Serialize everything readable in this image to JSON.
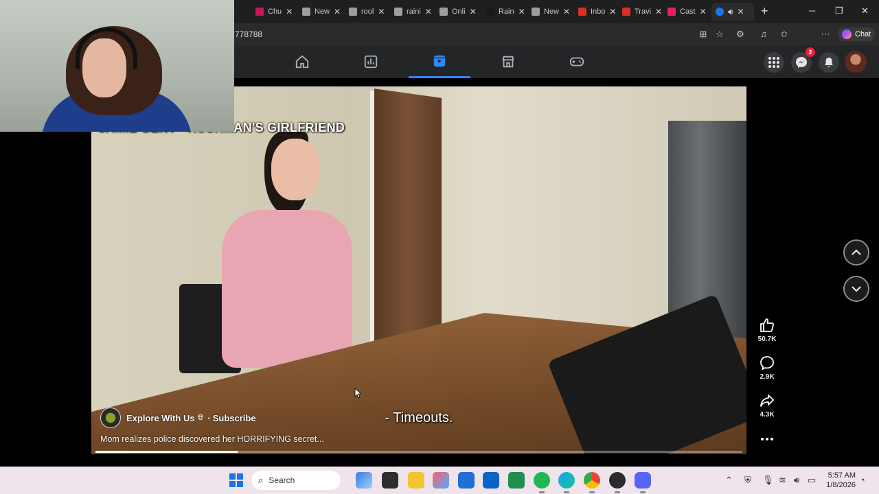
{
  "browser": {
    "tabs": [
      {
        "label": "",
        "favicon_color": "#6b6b6b"
      },
      {
        "label": "Chu",
        "favicon_color": "#c2185b"
      },
      {
        "label": "New",
        "favicon_color": "#9e9e9e"
      },
      {
        "label": "rool",
        "favicon_color": "#9e9e9e"
      },
      {
        "label": "raini",
        "favicon_color": "#9e9e9e"
      },
      {
        "label": "Onli",
        "favicon_color": "#9e9e9e"
      },
      {
        "label": "Rain",
        "favicon_color": "#1a1a1a"
      },
      {
        "label": "New",
        "favicon_color": "#9e9e9e"
      },
      {
        "label": "Inbo",
        "favicon_color": "#d93025"
      },
      {
        "label": "Travi",
        "favicon_color": "#d93025"
      },
      {
        "label": "Cast",
        "favicon_color": "#e91e63"
      }
    ],
    "url": "778788",
    "chat_label": "Chat"
  },
  "facebook": {
    "messenger_badge": "2",
    "active_tab": "reels"
  },
  "reel": {
    "top_caption": "JAMIE GENT - RUSHMAN'S GIRLFRIEND",
    "subtitle": "- Timeouts.",
    "channel_name": "Explore With Us",
    "subscribe_label": "Subscribe",
    "separator": "·",
    "description": "Mom realizes police discovered her HORRIFYING secret...",
    "progress": 0.22,
    "likes": "50.7K",
    "comments": "2.9K",
    "shares": "4.3K"
  },
  "taskbar": {
    "search_placeholder": "Search",
    "time": "5:57 AM",
    "date": "1/8/2026"
  },
  "colors": {
    "accent": "#2d88ff",
    "fb_bar": "#242526",
    "taskbar": "#efe3ec"
  }
}
